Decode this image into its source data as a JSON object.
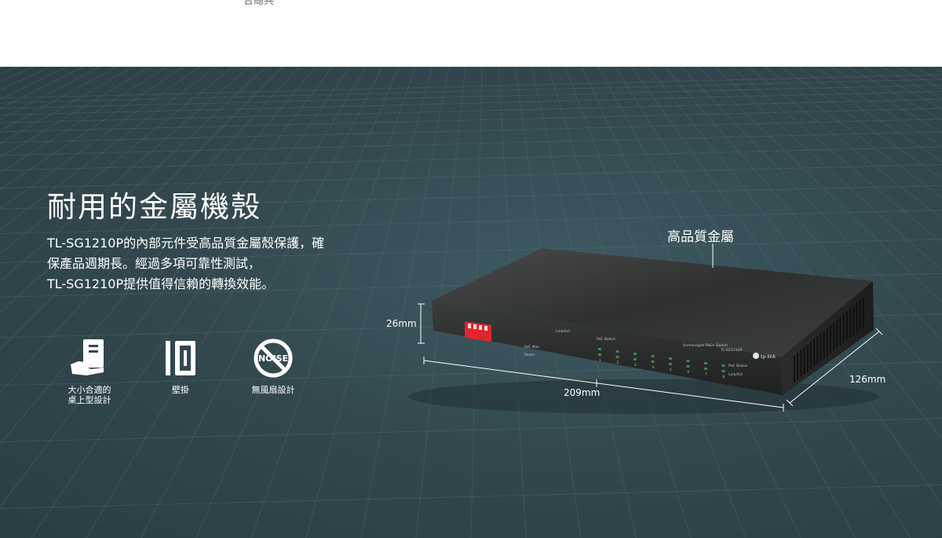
{
  "top_snippet": {
    "text": "合總共 ",
    "highlight": ""
  },
  "hero": {
    "title": "耐用的金屬機殼",
    "description": [
      "TL-SG1210P的內部元件受高品質金屬殼保護，確",
      "保產品週期長。經過多項可靠性測試，",
      "TL-SG1210P提供值得信賴的轉換效能。"
    ],
    "features": [
      {
        "icon": "desktop-size-icon",
        "label_lines": [
          "大小合適的",
          "桌上型設計"
        ]
      },
      {
        "icon": "wall-mount-icon",
        "label_lines": [
          "壁掛"
        ]
      },
      {
        "icon": "no-noise-icon",
        "label_lines": [
          "無風扇設計"
        ],
        "icon_text": "NOISE"
      }
    ],
    "callout": "高品質金屬",
    "dimensions": {
      "height": "26mm",
      "width": "209mm",
      "depth": "126mm"
    },
    "device_labels": {
      "model": "TL-SG1210P",
      "brand": "tp-link",
      "switch_type": "Unmanaged PoE+ Switch",
      "led_power": "Power",
      "led_poe_max": "PoE Max",
      "led_poe_status": "PoE Status",
      "led_link_act": "Link/Act",
      "port_numbers": [
        "1",
        "2",
        "3",
        "4",
        "5",
        "6",
        "7",
        "8"
      ]
    }
  },
  "colors": {
    "hero_bg": "#33494f",
    "text": "#ffffff",
    "dip_switch": "#e3242b",
    "device_top": "#3a3c3c"
  }
}
